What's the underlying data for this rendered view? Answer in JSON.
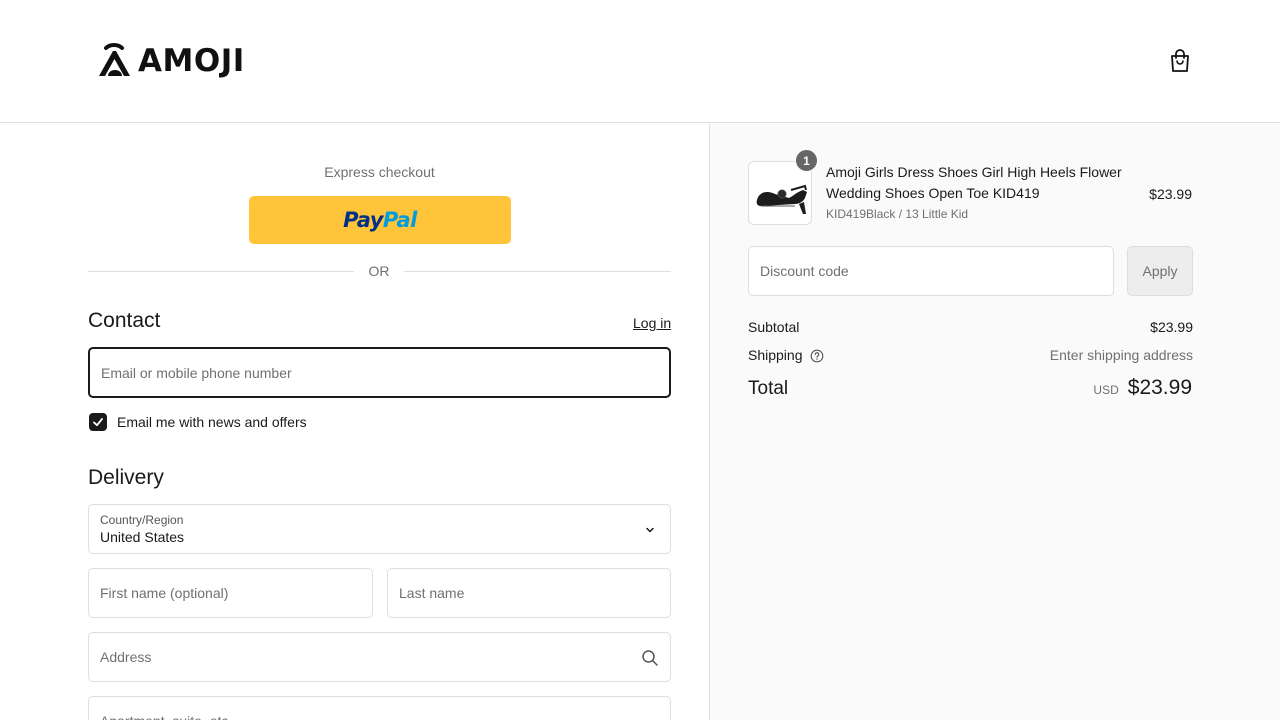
{
  "header": {
    "brand": "AMOJI",
    "cart_icon": "shopping-bag-icon"
  },
  "checkout": {
    "express_title": "Express checkout",
    "paypal": {
      "pay": "Pay",
      "pal": "Pal"
    },
    "or_text": "OR",
    "contact": {
      "title": "Contact",
      "login_label": "Log in",
      "email_placeholder": "Email or mobile phone number",
      "newsletter_label": "Email me with news and offers",
      "newsletter_checked": true
    },
    "delivery": {
      "title": "Delivery",
      "country_label": "Country/Region",
      "country_value": "United States",
      "first_name_placeholder": "First name (optional)",
      "last_name_placeholder": "Last name",
      "address_placeholder": "Address",
      "apartment_placeholder": "Apartment, suite, etc."
    }
  },
  "summary": {
    "product": {
      "quantity": "1",
      "name": "Amoji Girls Dress Shoes Girl High Heels Flower Wedding Shoes Open Toe KID419",
      "variant": "KID419Black / 13 Little Kid",
      "price": "$23.99"
    },
    "discount_placeholder": "Discount code",
    "apply_label": "Apply",
    "subtotal_label": "Subtotal",
    "subtotal_value": "$23.99",
    "shipping_label": "Shipping",
    "shipping_value": "Enter shipping address",
    "total_label": "Total",
    "currency": "USD",
    "total_value": "$23.99"
  },
  "colors": {
    "paypal_yellow": "#ffc439",
    "paypal_dark_blue": "#003087",
    "paypal_light_blue": "#009cde",
    "text": "#1a1a1a",
    "muted": "#707070",
    "border": "#dedede",
    "summary_bg": "#fafafa"
  }
}
